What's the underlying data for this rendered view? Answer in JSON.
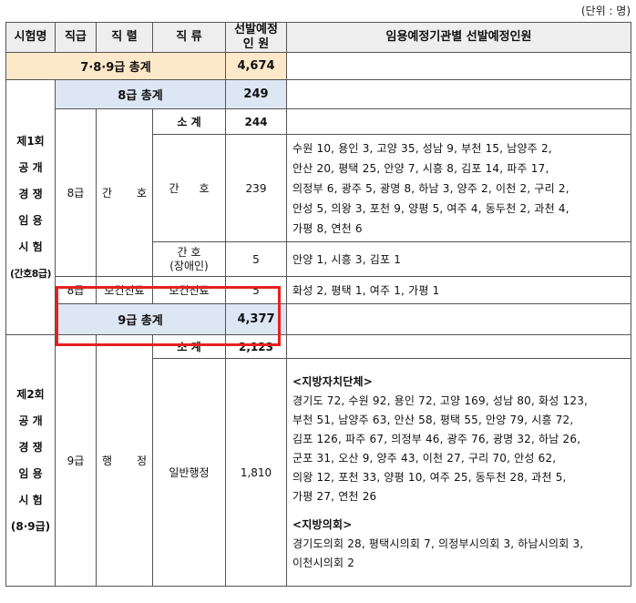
{
  "unit": "(단위 : 명)",
  "header": {
    "exam": "시험명",
    "grade": "직급",
    "series": "직 렬",
    "kind": "직 류",
    "count_line1": "선발예정",
    "count_line2": "인 원",
    "dist": "임용예정기관별 선발예정인원"
  },
  "grand_total": {
    "label": "7·8·9급 총계",
    "value": "4,674"
  },
  "exam1": {
    "lines": [
      "제1회",
      "공 개",
      "경 쟁",
      "임 용",
      "시 험",
      "(간호8급)"
    ],
    "subtotal": {
      "label": "8급 총계",
      "value": "249"
    },
    "grade": "8급",
    "series_a": "간",
    "series_b": "호",
    "small_label": "소 계",
    "small_value": "244",
    "rows": [
      {
        "kind_a": "간",
        "kind_b": "호",
        "value": "239",
        "dist": [
          "수원 10, 용인 3, 고양 35, 성남 9, 부천 15, 남양주 2,",
          "안산 20, 평택 25, 안양 7, 시흥 8, 김포 14, 파주 17,",
          "의정부 6, 광주 5, 광명 8, 하남 3, 양주 2, 이천 2, 구리 2,",
          "안성 5, 의왕 3, 포천 9, 양평 5, 여주 4, 동두천 2, 과천 4,",
          "가평 8, 연천 6"
        ]
      },
      {
        "kind_line1": "간 호",
        "kind_line2": "(장애인)",
        "value": "5",
        "dist": "안양 1, 시흥 3, 김포 1"
      }
    ],
    "extra": {
      "grade": "8급",
      "series": "보건진료",
      "kind": "보건진료",
      "value": "5",
      "dist": "화성 2, 평택 1, 여주 1, 가평 1"
    }
  },
  "exam2": {
    "lines": [
      "제2회",
      "공 개",
      "경 쟁",
      "임 용",
      "시 험",
      "(8·9급)"
    ],
    "subtotal": {
      "label": "9급 총계",
      "value": "4,377"
    },
    "grade": "9급",
    "series_a": "행",
    "series_b": "정",
    "small_label": "소 계",
    "small_value": "2,123",
    "kind": "일반행정",
    "value": "1,810",
    "local_title": "<지방자치단체>",
    "local_dist": [
      "경기도 72, 수원 92, 용인 72, 고양 169, 성남 80, 화성 123,",
      "부천 51, 남양주 63, 안산 58, 평택 55, 안양 79, 시흥 72,",
      "김포 126, 파주 67, 의정부 46, 광주 76, 광명 32, 하남 26,",
      "군포 31, 오산 9, 양주 43, 이천 27, 구리 70, 안성 62,",
      "의왕 12, 포천 33, 양평 10, 여주 25, 동두천 28, 과천 5,",
      "가평 27, 연천 26"
    ],
    "council_title": "<지방의회>",
    "council_dist": [
      "경기도의회 28, 평택시의회 7, 의정부시의회 3, 하남시의회 3,",
      "이천시의회 2"
    ]
  },
  "highlight_color": "#e8201f"
}
